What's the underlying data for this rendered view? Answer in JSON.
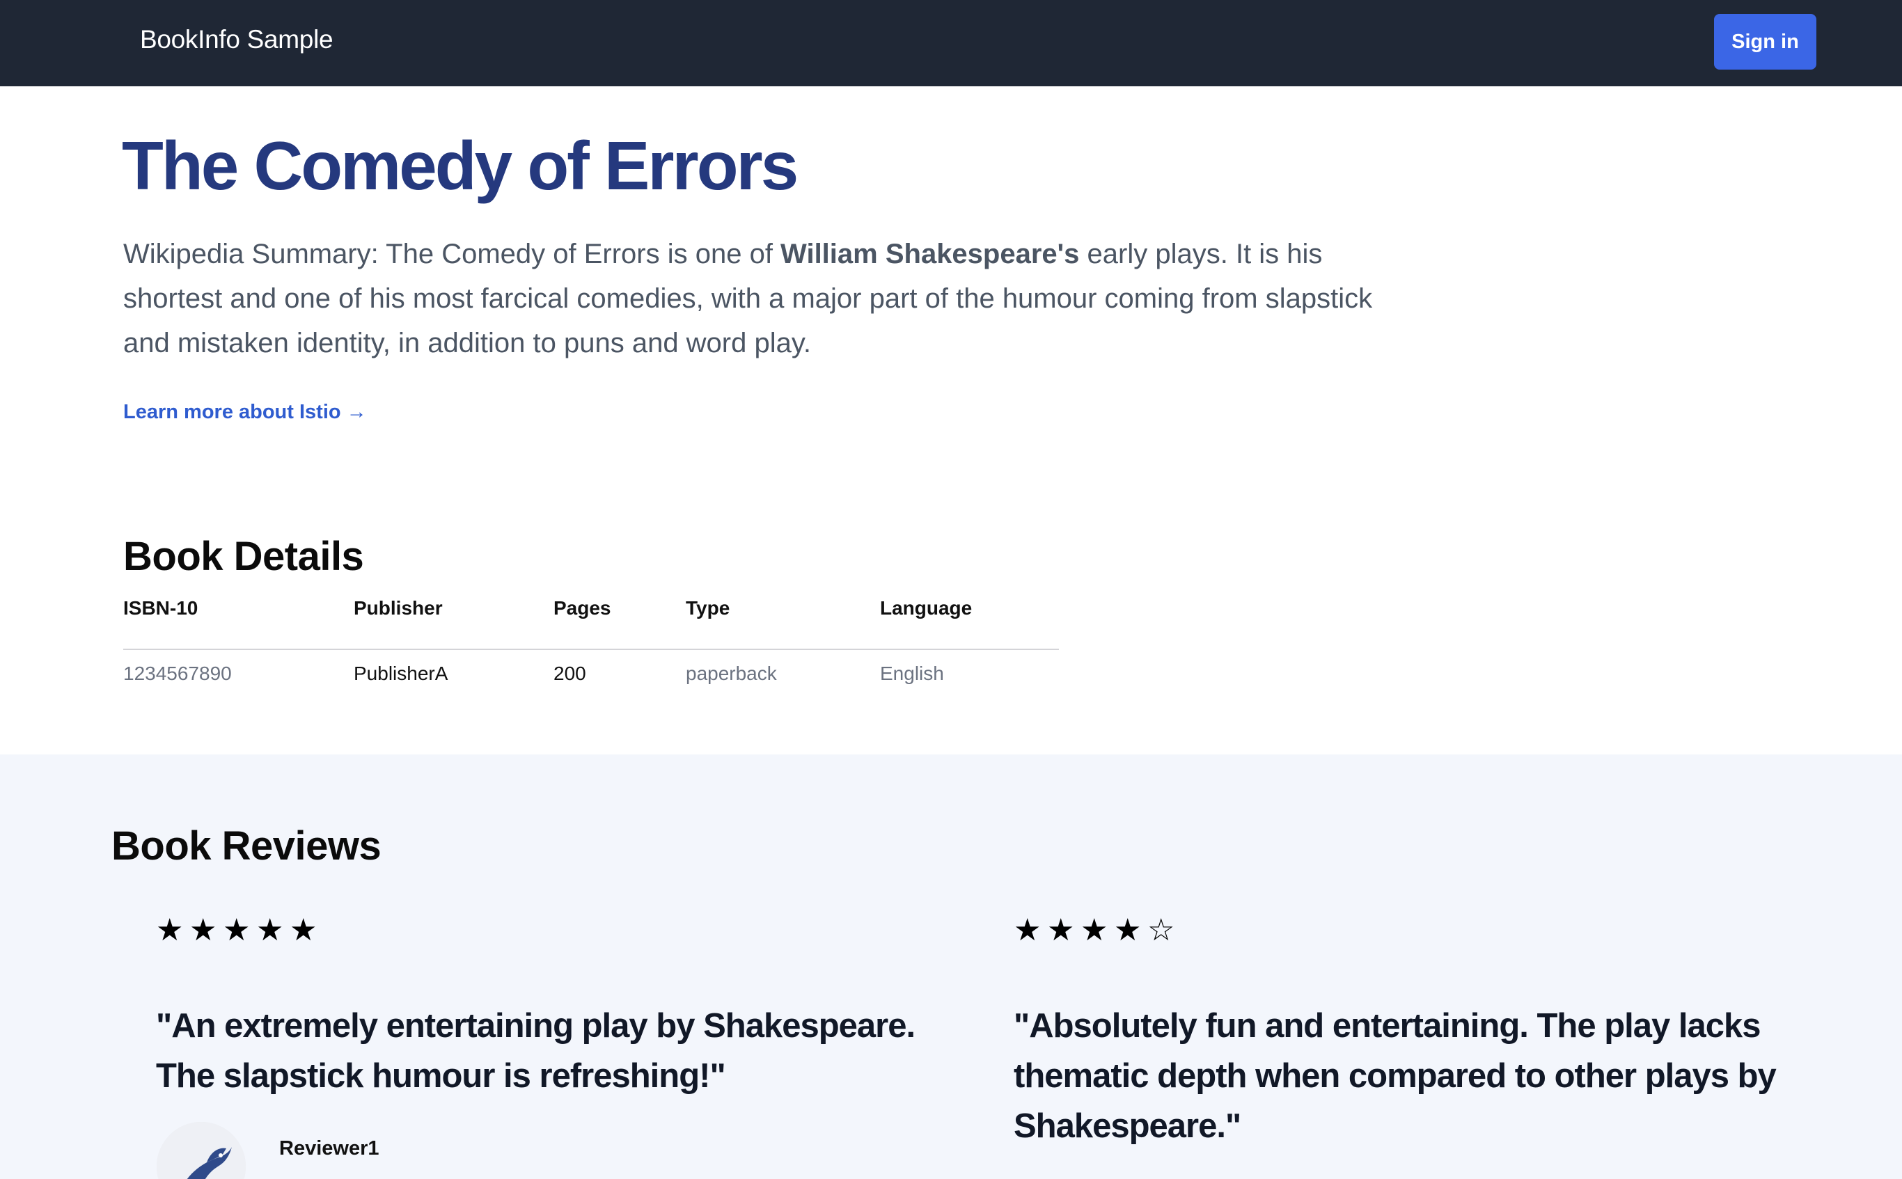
{
  "navbar": {
    "brand": "BookInfo Sample",
    "sign_in_label": "Sign in"
  },
  "book": {
    "title": "The Comedy of Errors",
    "summary_prefix": "Wikipedia Summary: The Comedy of Errors is one of ",
    "summary_bold": "William Shakespeare's",
    "summary_suffix": " early plays. It is his shortest and one of his most farcical comedies, with a major part of the humour coming from slapstick and mistaken identity, in addition to puns and word play.",
    "learn_more": "Learn more about Istio →"
  },
  "details": {
    "heading": "Book Details",
    "columns": [
      "ISBN-10",
      "Publisher",
      "Pages",
      "Type",
      "Language"
    ],
    "row": [
      "1234567890",
      "PublisherA",
      "200",
      "paperback",
      "English"
    ]
  },
  "reviews": {
    "heading": "Book Reviews",
    "items": [
      {
        "rating": 5,
        "max_rating": 5,
        "text": "\"An extremely entertaining play by Shakespeare. The slapstick humour is refreshing!\"",
        "reviewer": "Reviewer1"
      },
      {
        "rating": 4,
        "max_rating": 5,
        "text": "\"Absolutely fun and entertaining. The play lacks thematic depth when compared to other plays by Shakespeare.\""
      }
    ]
  },
  "colors": {
    "navbar": "#1f2735",
    "accent": "#3b66e6",
    "title": "#25397e",
    "reviews_background": "#f3f6fc"
  },
  "icons": {
    "filled_star": "star-icon",
    "empty_star": "star-outline-icon",
    "avatar": "dolphin-avatar"
  }
}
